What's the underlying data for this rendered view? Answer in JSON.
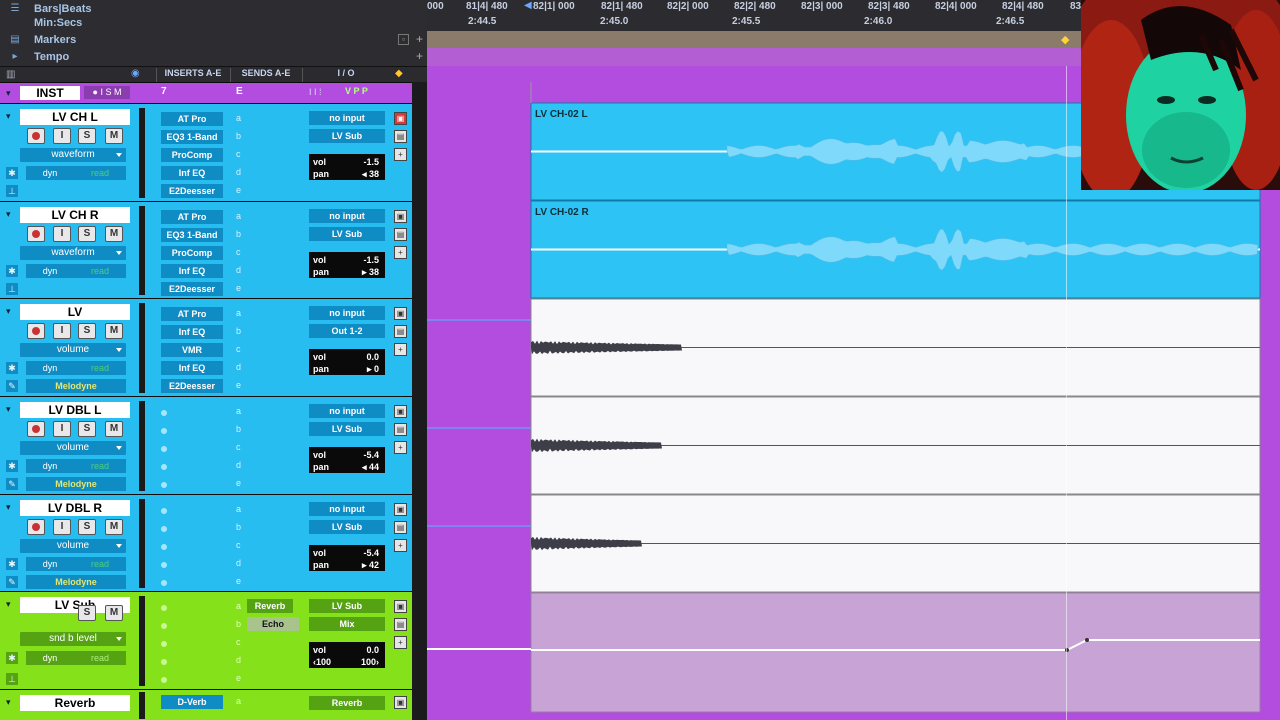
{
  "rulers": [
    {
      "label": "Bars|Beats",
      "icon": "bars-beats-icon"
    },
    {
      "label": "Min:Secs",
      "icon": "none"
    },
    {
      "label": "Markers",
      "icon": "marker-icon"
    },
    {
      "label": "Tempo",
      "icon": "tempo-icon"
    }
  ],
  "timeline": {
    "bars": [
      "000",
      "81|4| 480",
      "82|1| 000",
      "82|1| 480",
      "82|2| 000",
      "82|2| 480",
      "82|3| 000",
      "82|3| 480",
      "82|4| 000",
      "82|4| 480",
      "83"
    ],
    "secs": [
      "2:44.5",
      "2:45.0",
      "2:45.5",
      "2:46.0",
      "2:46.5"
    ]
  },
  "column_headers": {
    "inserts": "INSERTS A-E",
    "sends": "SENDS A-E",
    "io": "I / O"
  },
  "inst_track": {
    "name": "INST",
    "inserts_label": "7",
    "sends_label": "E"
  },
  "tracks": [
    {
      "name": "LV CH L",
      "view": "waveform",
      "inserts": [
        "AT Pro",
        "EQ3 1-Band",
        "ProComp",
        "Inf EQ",
        "E2Deesser"
      ],
      "input": "no input",
      "output": "LV Sub",
      "vol": "-1.5",
      "pan": "38",
      "pan_dir": "◂",
      "clip": "LV CH-02 L"
    },
    {
      "name": "LV CH R",
      "view": "waveform",
      "inserts": [
        "AT Pro",
        "EQ3 1-Band",
        "ProComp",
        "Inf EQ",
        "E2Deesser"
      ],
      "input": "no input",
      "output": "LV Sub",
      "vol": "-1.5",
      "pan": "38",
      "pan_dir": "▸",
      "clip": "LV CH-02 R"
    },
    {
      "name": "LV",
      "view": "volume",
      "inserts": [
        "AT Pro",
        "Inf EQ",
        "VMR",
        "Inf EQ",
        "E2Deesser"
      ],
      "input": "no input",
      "output": "Out 1-2",
      "vol": "0.0",
      "pan": "0",
      "pan_dir": "▸",
      "plugin": "Melodyne",
      "clip": ""
    },
    {
      "name": "LV DBL L",
      "view": "volume",
      "inserts": [],
      "input": "no input",
      "output": "LV Sub",
      "vol": "-5.4",
      "pan": "44",
      "pan_dir": "◂",
      "plugin": "Melodyne",
      "clip": ""
    },
    {
      "name": "LV DBL R",
      "view": "volume",
      "inserts": [],
      "input": "no input",
      "output": "LV Sub",
      "vol": "-5.4",
      "pan": "42",
      "pan_dir": "▸",
      "plugin": "Melodyne",
      "clip": ""
    },
    {
      "name": "LV Sub",
      "view": "snd b level",
      "sends": [
        "Reverb",
        "Echo"
      ],
      "input": "LV Sub",
      "output": "Mix",
      "vol": "0.0",
      "pan_l": "100",
      "pan_r": "100"
    },
    {
      "name": "Reverb",
      "inserts": [
        "D-Verb"
      ],
      "output": "Reverb"
    }
  ],
  "labels": {
    "dyn": "dyn",
    "read": "read",
    "vol": "vol",
    "pan": "pan",
    "a": "a",
    "b": "b",
    "c": "c",
    "d": "d",
    "e": "e",
    "S": "S",
    "M": "M",
    "I": "I"
  },
  "colors": {
    "audio": "#28bdf0",
    "aux": "#84e11a",
    "inst": "#b24de0",
    "tempo": "#b45ed4"
  }
}
